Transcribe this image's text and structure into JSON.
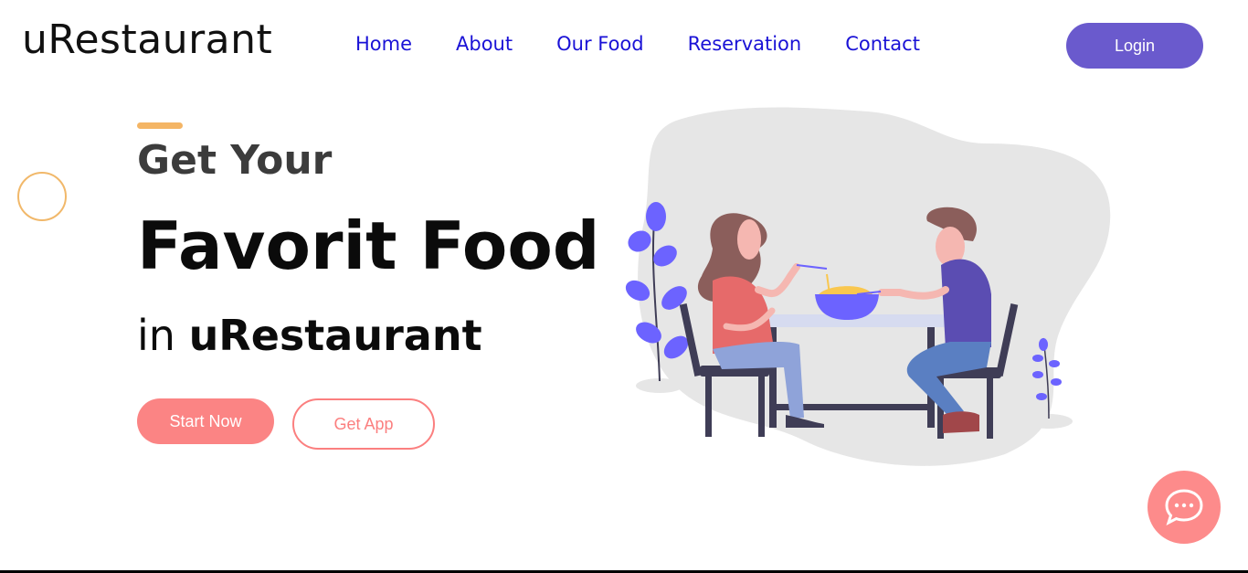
{
  "header": {
    "logo": "uRestaurant",
    "nav": [
      {
        "label": "Home"
      },
      {
        "label": "About"
      },
      {
        "label": "Our Food"
      },
      {
        "label": "Reservation"
      },
      {
        "label": "Contact"
      }
    ],
    "login_label": "Login"
  },
  "hero": {
    "line1": "Get Your",
    "line2": "Favorit Food",
    "line3_prefix": "in",
    "line3_brand": "uRestaurant",
    "start_label": "Start Now",
    "app_label": "Get App"
  },
  "illustration": {
    "name": "couple-dining-illustration"
  },
  "chat": {
    "icon": "chat-bubble-icon"
  },
  "colors": {
    "nav_link": "#1a12d6",
    "login_bg": "#6a5acd",
    "accent": "#f4b565",
    "coral": "#fb8484",
    "blob": "#e6e6e6",
    "purple": "#6c63ff"
  }
}
